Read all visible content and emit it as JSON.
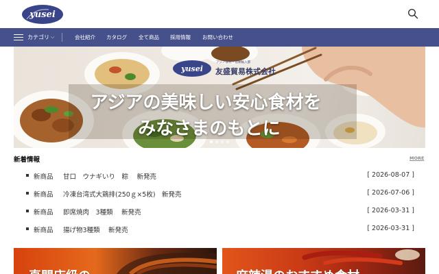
{
  "header": {
    "logo_text": "yusei",
    "search_icon": "search-icon"
  },
  "nav": {
    "category_label": "カテゴリ",
    "links": [
      "会社紹介",
      "カタログ",
      "全て商品",
      "採用情報",
      "お問い合わせ"
    ]
  },
  "hero": {
    "logo_text": "yusei",
    "tagline": "アジア食材・酒類輸入卸",
    "company": "友盛貿易株式会社",
    "headline_1": "アジアの美味しい安心食材を",
    "headline_2": "みなさまのもとに",
    "slide_count": 4,
    "active_slide": 1
  },
  "news": {
    "title": "新着情報",
    "more_label": "MORE",
    "items": [
      {
        "category": "新商品",
        "title": "甘口　ウナギいり　粽　 新発売",
        "date": "[ 2026-08-07 ]"
      },
      {
        "category": "新商品",
        "title": "冷凍台湾式大鶏排(250ｇ×5枚)　新発売",
        "date": "[ 2026-07-06 ]"
      },
      {
        "category": "新商品",
        "title": "即席焼肉　3種類　 新発売",
        "date": "[ 2026-03-31 ]"
      },
      {
        "category": "新商品",
        "title": "揚げ物3種類　 新発売",
        "date": "[ 2026-03-31 ]"
      }
    ]
  },
  "banners": [
    {
      "text": "直間店級の"
    },
    {
      "text": "麻辣湯のおすすめ食材"
    }
  ],
  "colors": {
    "nav_bg": "#46508b",
    "brand": "#3a4488"
  }
}
